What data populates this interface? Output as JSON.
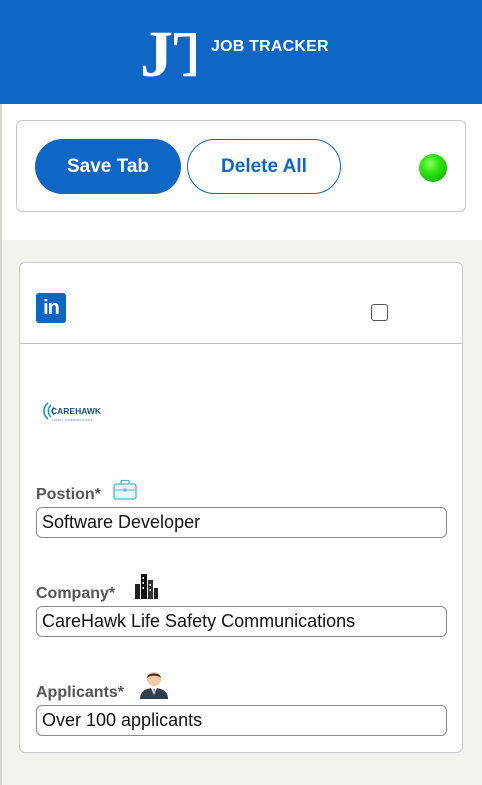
{
  "header": {
    "logo_text": "JT",
    "title": "JOB TRACKER"
  },
  "controls": {
    "save_label": "Save Tab",
    "delete_label": "Delete All",
    "status_color": "#2fe812"
  },
  "job": {
    "source_icon": "linkedin-icon",
    "source_text": "in",
    "company_logo_icon": "carehawk-logo",
    "company_logo_text": "CAREHAWK",
    "company_logo_tagline": "SAFETY COMMUNICATIONS",
    "fields": {
      "position": {
        "label": "Postion*",
        "value": "Software Developer",
        "icon": "briefcase-icon"
      },
      "company": {
        "label": "Company*",
        "value": "CareHawk Life Safety Communications",
        "icon": "buildings-icon"
      },
      "applicants": {
        "label": "Applicants*",
        "value": "Over 100 applicants",
        "icon": "person-icon"
      }
    }
  },
  "colors": {
    "brand_blue": "#0f66c4",
    "linkedin_blue": "#0a66c2",
    "background": "#f3f2ed"
  }
}
